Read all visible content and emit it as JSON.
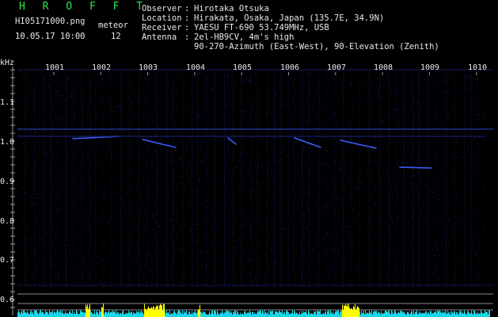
{
  "header": {
    "app_title": "H R O F F T",
    "filename": "HI05171000.png",
    "datetime": "10.05.17 10:00",
    "meteor_label": "meteor",
    "meteor_count": "12",
    "observer_key": "Observer",
    "observer_val": "Hirotaka Otsuka",
    "location_key": "Location",
    "location_val": "Hirakata, Osaka, Japan (135.7E, 34.9N)",
    "receiver_key": "Receiver",
    "receiver_val": "YAESU FT-690 53.749MHz, USB",
    "antenna_key": "Antenna",
    "antenna_val1": "2el-HB9CV, 4m's high",
    "antenna_val2": "90-270-Azimuth (East-West), 90-Elevation (Zenith)",
    "sep": ":"
  },
  "axis": {
    "y_unit": "kHz",
    "y_ticks": [
      "1.1",
      "1.0",
      "0.9",
      "0.8",
      "0.7",
      "0.6"
    ],
    "x_ticks": [
      "1001",
      "1002",
      "1003",
      "1004",
      "1005",
      "1006",
      "1007",
      "1008",
      "1009",
      "1010"
    ]
  },
  "colors": {
    "background": "#000000",
    "title_green": "#2ee84a",
    "signal_blue": "#3a5cff",
    "noise_blue": "#1a1f6e",
    "bar_cyan": "#19d6e6",
    "bar_yellow": "#ffff00",
    "axis_gray": "#9a9a9a"
  }
}
